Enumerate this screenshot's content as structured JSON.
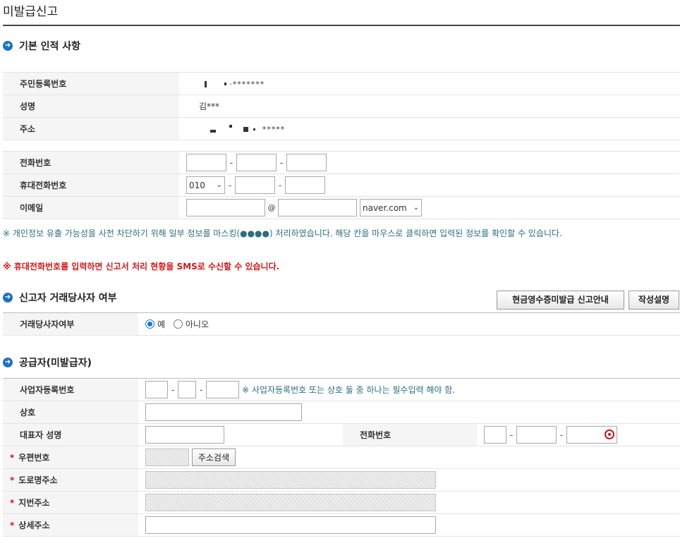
{
  "page": {
    "title": "미발급신고"
  },
  "sections": {
    "basic": "기본 인적 사항",
    "relation": "신고자 거래당사자 여부",
    "supplier": "공급자(미발급자)"
  },
  "basic_info": {
    "rrn_label": "주민등록번호",
    "rrn_value": "·*******",
    "name_label": "성명",
    "name_value": "김***",
    "addr_label": "주소",
    "addr_value": "*****"
  },
  "contact": {
    "phone_label": "전화번호",
    "mobile_label": "휴대전화번호",
    "mobile_prefix": "010",
    "email_label": "이메일",
    "at": "@",
    "email_domain": "naver.com"
  },
  "notice": "※ 개인정보 유출 가능성을 사전 차단하기 위해 일부 정보를 마스킹(●●●●) 처리하였습니다. 해당 칸을 마우스로 클릭하면 입력된 정보를 확인할 수 있습니다.",
  "warning": "※ 휴대전화번호를 입력하면 신고서 처리 현황을 SMS로 수신할 수 있습니다.",
  "buttons": {
    "guide": "현금영수증미발급 신고안내",
    "write_help": "작성설명",
    "addr_search": "주소검색"
  },
  "relation": {
    "label": "거래당사자여부",
    "yes": "예",
    "no": "아니오"
  },
  "supplier": {
    "bizno_label": "사업자등록번호",
    "bizno_hint": "※ 사업자등록번호 또는 상호 둘 중 하나는 필수입력 해야 함.",
    "company_label": "상호",
    "rep_label": "대표자 성명",
    "phone_label": "전화번호",
    "zip_label": "우편번호",
    "road_label": "도로명주소",
    "jibun_label": "지번주소",
    "detail_label": "상세주소",
    "required_mark": "*"
  },
  "colors": {
    "accent": "#1e73be",
    "warning": "#d2181b",
    "notice": "#2a6f7a"
  }
}
